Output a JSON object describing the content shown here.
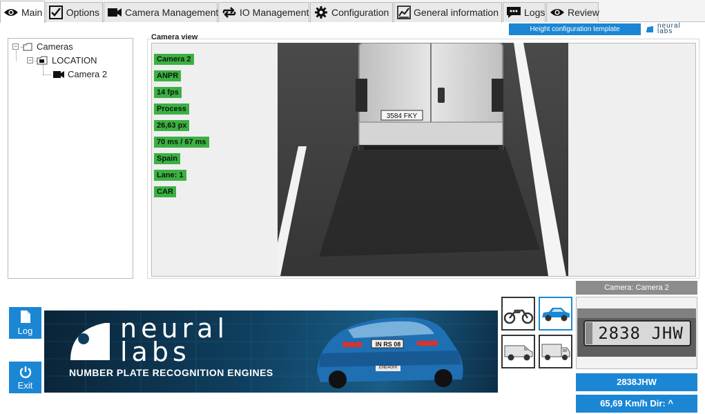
{
  "tabs": [
    {
      "label": "Main",
      "icon": "eye-icon",
      "active": true
    },
    {
      "label": "Options",
      "icon": "checkbox-icon"
    },
    {
      "label": "Camera Management",
      "icon": "video-camera-icon"
    },
    {
      "label": "IO Management",
      "icon": "swap-arrows-icon"
    },
    {
      "label": "Configuration",
      "icon": "gear-icon"
    },
    {
      "label": "General information",
      "icon": "chart-icon"
    },
    {
      "label": "Logs",
      "icon": "log-icon"
    },
    {
      "label": "Review",
      "icon": "eye-icon"
    }
  ],
  "tree": {
    "root": "Cameras",
    "location": "LOCATION",
    "camera": "Camera 2"
  },
  "camera_view": {
    "title": "Camera view",
    "badges": [
      "Camera 2",
      "ANPR",
      "14 fps",
      "Process",
      "26,63 px",
      "70 ms / 67 ms",
      "Spain",
      "Lane: 1",
      "CAR"
    ],
    "van_plate": "3584 FKY"
  },
  "header": {
    "template_button": "Height configuration template",
    "brand_top": "neural",
    "brand_bottom": "labs"
  },
  "side_buttons": {
    "log": "Log",
    "exit": "Exit"
  },
  "banner": {
    "brand_top": "neural",
    "brand_bottom": "labs",
    "tagline": "NUMBER PLATE RECOGNITION ENGINES",
    "car_plate": "IN RS 08",
    "car_plate2": "ENE4GHI"
  },
  "vehicle_types": [
    {
      "name": "motorcycle",
      "selected": false
    },
    {
      "name": "car",
      "selected": true
    },
    {
      "name": "van",
      "selected": false
    },
    {
      "name": "truck",
      "selected": false
    }
  ],
  "result": {
    "camera_label": "Camera: Camera 2",
    "plate_image_text": "2838 JHW",
    "plate_text": "2838JHW",
    "speed_text": "65,69 Km/h Dir: ^"
  },
  "colors": {
    "accent": "#1b87d4",
    "badge_green": "#3cb043",
    "gray_header": "#8c8c8c"
  }
}
